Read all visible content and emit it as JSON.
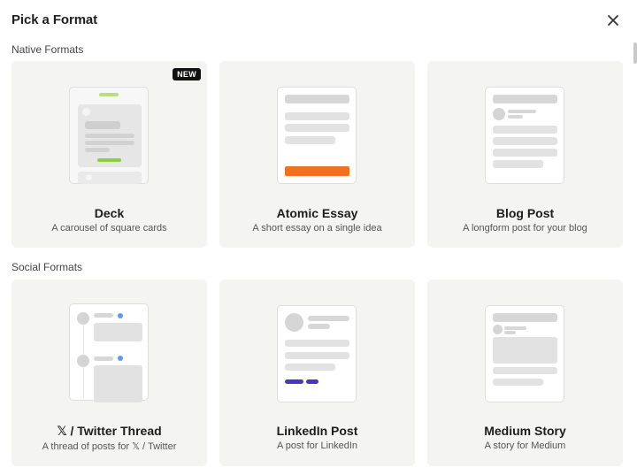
{
  "dialog": {
    "title": "Pick a Format"
  },
  "sections": {
    "native": "Native Formats",
    "social": "Social Formats"
  },
  "cards": {
    "deck": {
      "title": "Deck",
      "desc": "A carousel of square cards",
      "badge": "NEW"
    },
    "atomic": {
      "title": "Atomic Essay",
      "desc": "A short essay on a single idea"
    },
    "blog": {
      "title": "Blog Post",
      "desc": "A longform post for your blog"
    },
    "twitter": {
      "title": "𝕏 / Twitter Thread",
      "desc": "A thread of posts for 𝕏 / Twitter"
    },
    "linkedin": {
      "title": "LinkedIn Post",
      "desc": "A post for LinkedIn"
    },
    "medium": {
      "title": "Medium Story",
      "desc": "A story for Medium"
    }
  },
  "colors": {
    "accent_green": "#8bd03a",
    "accent_orange": "#f0721f",
    "accent_blue": "#5b9cf6",
    "accent_indigo": "#4637c7",
    "card_bg": "#f4f4f3"
  }
}
